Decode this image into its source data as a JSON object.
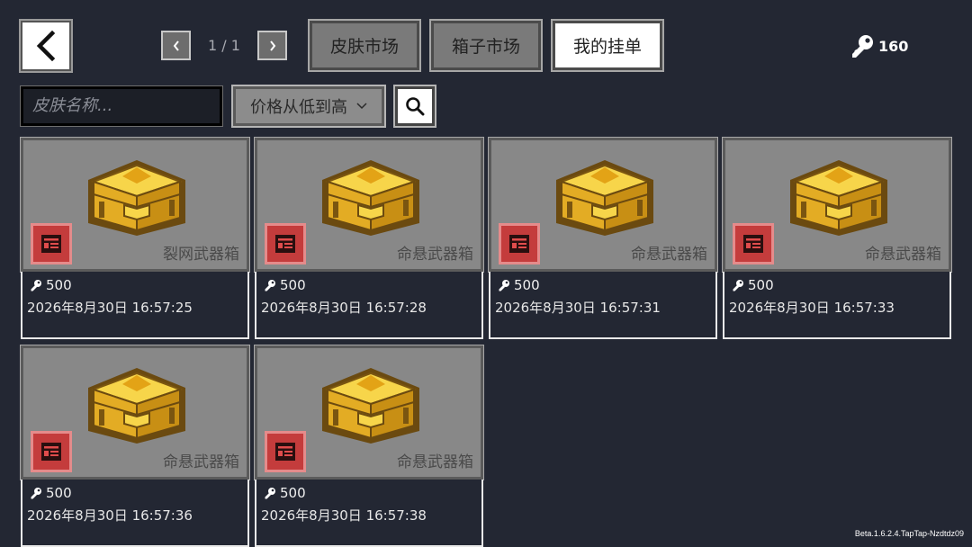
{
  "header": {
    "page_indicator": "1 / 1",
    "tabs": [
      {
        "label": "皮肤市场",
        "active": false
      },
      {
        "label": "箱子市场",
        "active": false
      },
      {
        "label": "我的挂单",
        "active": true
      }
    ],
    "key_count": "160"
  },
  "filters": {
    "search_placeholder": "皮肤名称...",
    "sort_label": "价格从低到高"
  },
  "listings": [
    {
      "name": "裂网武器箱",
      "price": "500",
      "date": "2026年8月30日 16:57:25"
    },
    {
      "name": "命悬武器箱",
      "price": "500",
      "date": "2026年8月30日 16:57:28"
    },
    {
      "name": "命悬武器箱",
      "price": "500",
      "date": "2026年8月30日 16:57:31"
    },
    {
      "name": "命悬武器箱",
      "price": "500",
      "date": "2026年8月30日 16:57:33"
    },
    {
      "name": "命悬武器箱",
      "price": "500",
      "date": "2026年8月30日 16:57:36"
    },
    {
      "name": "命悬武器箱",
      "price": "500",
      "date": "2026年8月30日 16:57:38"
    }
  ],
  "footer": {
    "version": "Beta.1.6.2.4.TapTap-Nzdtdz09"
  },
  "colors": {
    "background": "#232733",
    "card_gray": "#888888",
    "badge_red": "#c43c3c",
    "gold": "#e8b923"
  },
  "icons": [
    "back-arrow-icon",
    "chevron-left-icon",
    "chevron-right-icon",
    "key-icon",
    "chevron-down-icon",
    "search-icon",
    "market-listing-icon",
    "gold-chest-icon"
  ]
}
